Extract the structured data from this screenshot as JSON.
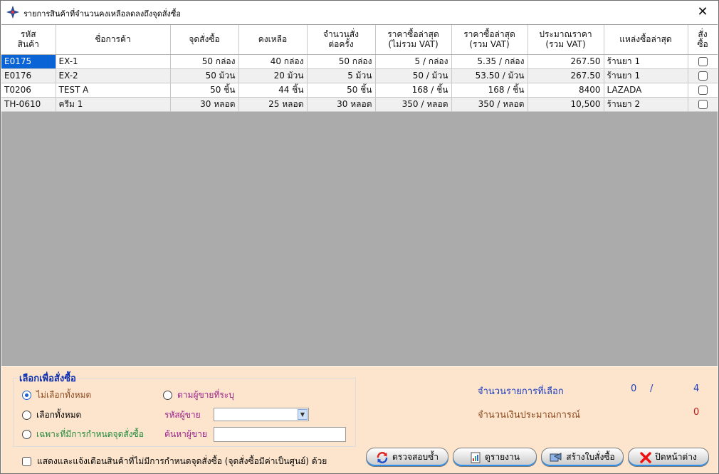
{
  "window": {
    "title": "รายการสินค้าที่จำนวนคงเหลือลดลงถึงจุดสั่งซื้อ",
    "close_label": "✕"
  },
  "grid": {
    "columns": [
      "รหัส\nสินค้า",
      "ชื่อการค้า",
      "จุดสั่งซื้อ",
      "คงเหลือ",
      "จำนวนสั่ง\nต่อครั้ง",
      "ราคาซื้อล่าสุด\n(ไม่รวม VAT)",
      "ราคาซื้อล่าสุด\n(รวม VAT)",
      "ประมาณราคา\n(รวม VAT)",
      "แหล่งซื้อล่าสุด",
      "สั่ง\nซื้อ"
    ],
    "rows": [
      {
        "code": "E0175",
        "name": "EX-1",
        "reorder": "50 กล่อง",
        "remaining": "40 กล่อง",
        "order_qty": "50 กล่อง",
        "price_ex_vat": "5 / กล่อง",
        "price_inc_vat": "5.35 / กล่อง",
        "estimate": "267.50",
        "source": "ร้านยา 1",
        "checked": false
      },
      {
        "code": "E0176",
        "name": "EX-2",
        "reorder": "50 ม้วน",
        "remaining": "20 ม้วน",
        "order_qty": "5 ม้วน",
        "price_ex_vat": "50 / ม้วน",
        "price_inc_vat": "53.50 / ม้วน",
        "estimate": "267.50",
        "source": "ร้านยา 1",
        "checked": false
      },
      {
        "code": "T0206",
        "name": "TEST A",
        "reorder": "50 ชิ้น",
        "remaining": "44 ชิ้น",
        "order_qty": "50 ชิ้น",
        "price_ex_vat": "168 / ชิ้น",
        "price_inc_vat": "168 / ชิ้น",
        "estimate": "8400",
        "source": "LAZADA",
        "checked": false
      },
      {
        "code": "TH-0610",
        "name": "ครีม 1",
        "reorder": "30 หลอด",
        "remaining": "25 หลอด",
        "order_qty": "30 หลอด",
        "price_ex_vat": "350 / หลอด",
        "price_inc_vat": "350 / หลอด",
        "estimate": "10,500",
        "source": "ร้านยา 2",
        "checked": false
      }
    ]
  },
  "select_group": {
    "title": "เลือกเพื่อสั่งซื้อ",
    "opt_none": "ไม่เลือกทั้งหมด",
    "opt_all": "เลือกทั้งหมด",
    "opt_reorder_only": "เฉพาะที่มีการกำหนดจุดสั่งซื้อ",
    "opt_by_vendor": "ตามผู้ขายที่ระบุ",
    "vendor_code_label": "รหัสผู้ขาย",
    "vendor_search_label": "ค้นหาผู้ขาย",
    "selected_option": "opt_none"
  },
  "show_unset_warning": "แสดงและแจ้งเตือนสินค้าที่ไม่มีการกำหนดจุดสั่งซื้อ (จุดสั่งซื้อมีค่าเป็นศูนย์) ด้วย",
  "summary": {
    "selected_count_label": "จำนวนรายการที่เลือก",
    "selected_count": "0",
    "separator": "/",
    "total_count": "4",
    "estimated_amount_label": "จำนวนเงินประมาณการณ์",
    "estimated_amount": "0"
  },
  "buttons": {
    "check_again": "ตรวจสอบซ้ำ",
    "view_report": "ดูรายงาน",
    "create_po": "สร้างใบสั่งซื้อ",
    "close_window": "ปิดหน้าต่าง"
  },
  "colors": {
    "bottom_panel_bg": "#fde5cd",
    "grid_empty_bg": "#ababab",
    "selected_cell_bg": "#0a64d6",
    "group_title": "#0b2fb0",
    "label_brown": "#8a4a1f",
    "label_purple": "#9a1f8a",
    "label_green": "#1e8a3a",
    "label_blue": "#1c3fbf",
    "value_red": "#c01515"
  }
}
